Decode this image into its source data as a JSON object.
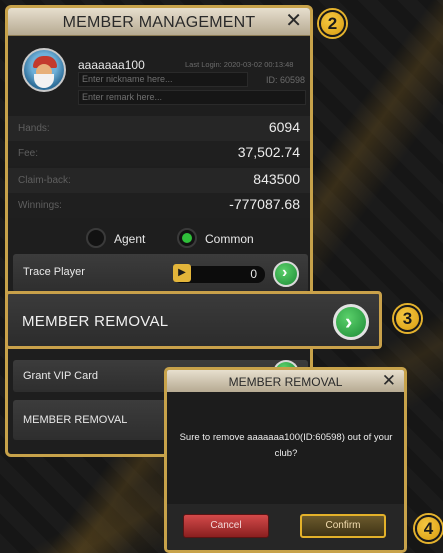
{
  "panel": {
    "title": "MEMBER MANAGEMENT",
    "close": "✕",
    "username": "aaaaaaa100",
    "last_login": "Last Login: 2020-03-02 00:13:48",
    "nickname_placeholder": "Enter nickname here...",
    "id_text": "ID: 60598",
    "remark_placeholder": "Enter remark here...",
    "stats": [
      {
        "label": "Hands:",
        "value": "6094"
      },
      {
        "label": "Fee:",
        "value": "37,502.74"
      },
      {
        "label": "Claim-back:",
        "value": "843500"
      },
      {
        "label": "Winnings:",
        "value": "-777087.68"
      }
    ],
    "roles": [
      {
        "label": "Agent",
        "selected": false
      },
      {
        "label": "Common",
        "selected": true
      }
    ],
    "trace_player": {
      "label": "Trace Player",
      "value": "0"
    },
    "member_removal_label": "MEMBER REMOVAL",
    "grant_vip_label": "Grant VIP Card",
    "member_removal_label_2": "MEMBER REMOVAL"
  },
  "steps": [
    "2",
    "3",
    "4"
  ],
  "dialog": {
    "title": "MEMBER REMOVAL",
    "close": "✕",
    "message": "Sure to remove aaaaaaa100(ID:60598) out of your club?",
    "cancel": "Cancel",
    "confirm": "Confirm"
  },
  "icons": {
    "go": "arrow-right-icon",
    "trace": "trace-icon",
    "avatar": "santa-avatar"
  },
  "colors": {
    "gold": "#c7a24a",
    "green": "#2fbf3a",
    "cancel_red": "#b83232"
  }
}
